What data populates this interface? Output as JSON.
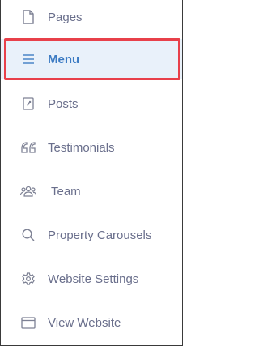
{
  "nav": {
    "items": [
      {
        "label": "Pages",
        "icon": "page-icon"
      },
      {
        "label": "Menu",
        "icon": "menu-icon",
        "active": true
      },
      {
        "label": "Posts",
        "icon": "post-icon"
      },
      {
        "label": "Testimonials",
        "icon": "quote-icon"
      },
      {
        "label": "Team",
        "icon": "team-icon"
      },
      {
        "label": "Property Carousels",
        "icon": "search-icon"
      },
      {
        "label": "Website Settings",
        "icon": "gear-icon"
      },
      {
        "label": "View Website",
        "icon": "browser-window-icon"
      }
    ]
  },
  "colors": {
    "text": "#6a6f8c",
    "active_text": "#3c7bc3",
    "active_background": "#e9f1fa",
    "highlight_border": "#e8404a"
  }
}
